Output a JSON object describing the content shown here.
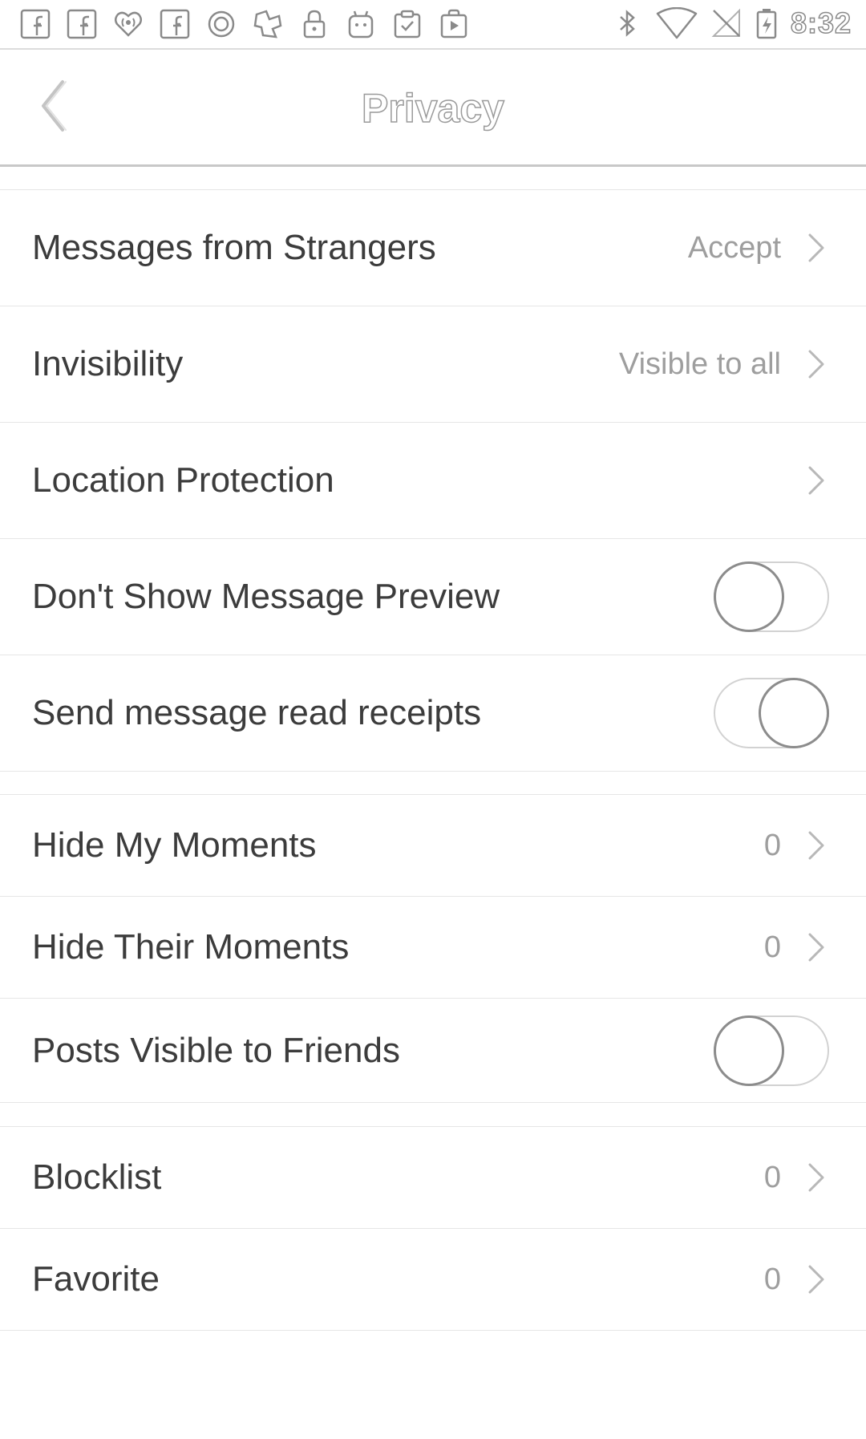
{
  "status_bar": {
    "time": "8:32",
    "left_icons": [
      "facebook-icon",
      "facebook-icon",
      "iheartradio-icon",
      "facebook-icon",
      "circle-app-icon",
      "puzzle-app-icon",
      "lock-icon",
      "android-icon",
      "clipboard-check-icon",
      "play-store-icon"
    ],
    "right_icons": [
      "bluetooth-icon",
      "wifi-icon",
      "no-signal-icon",
      "battery-charging-icon"
    ]
  },
  "header": {
    "title": "Privacy"
  },
  "section1": {
    "rows": [
      {
        "label": "Messages from Strangers",
        "value": "Accept"
      },
      {
        "label": "Invisibility",
        "value": "Visible to all"
      },
      {
        "label": "Location Protection",
        "value": ""
      },
      {
        "label": "Don't Show Message Preview",
        "toggle": "off"
      },
      {
        "label": "Send message read receipts",
        "toggle": "on"
      }
    ]
  },
  "section2": {
    "rows": [
      {
        "label": "Hide My Moments",
        "value": "0"
      },
      {
        "label": "Hide Their Moments",
        "value": "0"
      },
      {
        "label": "Posts Visible to Friends",
        "toggle": "off"
      }
    ]
  },
  "section3": {
    "rows": [
      {
        "label": "Blocklist",
        "value": "0"
      },
      {
        "label": "Favorite",
        "value": "0"
      }
    ]
  },
  "colors": {
    "background": "#ffffff",
    "label_text": "#3c3c3c",
    "value_text": "#9e9e9e",
    "divider": "#e6e6e6",
    "header_border": "#c8c8c8"
  }
}
